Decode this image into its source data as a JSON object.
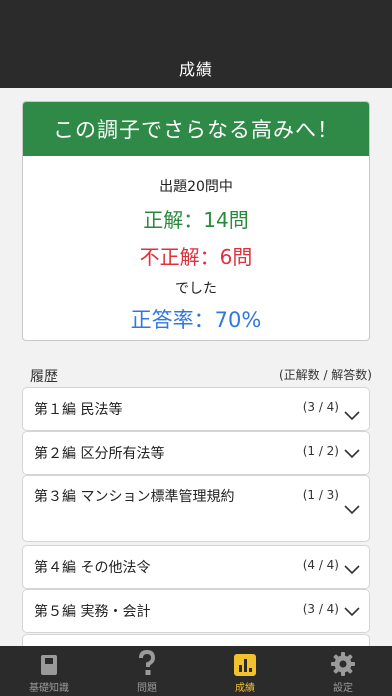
{
  "nav": {
    "title": "成績"
  },
  "result": {
    "banner": "この調子でさらなる高みへ！",
    "total": "出題20問中",
    "correct": "正解：14問",
    "incorrect": "不正解：6問",
    "deshita": "でした",
    "rate": "正答率：70%"
  },
  "history": {
    "label": "履歴",
    "columns": "(正解数 / 解答数)",
    "rows": [
      {
        "name": "第１編 民法等",
        "score": "(3 / 4)"
      },
      {
        "name": "第２編 区分所有法等",
        "score": "(1 / 2)"
      },
      {
        "name": "第３編 マンション標準管理規約",
        "score": "(1 / 3)"
      },
      {
        "name": "第４編 その他法令",
        "score": "(4 / 4)"
      },
      {
        "name": "第５編 実務・会計",
        "score": "(3 / 4)"
      }
    ]
  },
  "tabs": [
    {
      "label": "基礎知識",
      "icon": "book-icon"
    },
    {
      "label": "問題",
      "icon": "question-icon"
    },
    {
      "label": "成績",
      "icon": "bar-chart-icon",
      "active": true
    },
    {
      "label": "設定",
      "icon": "gear-icon"
    }
  ],
  "colors": {
    "banner": "#2e8a46",
    "correct": "#2a8a3c",
    "incorrect": "#e0303c",
    "rate": "#2f78e0",
    "active_tab": "#f2c12e"
  }
}
